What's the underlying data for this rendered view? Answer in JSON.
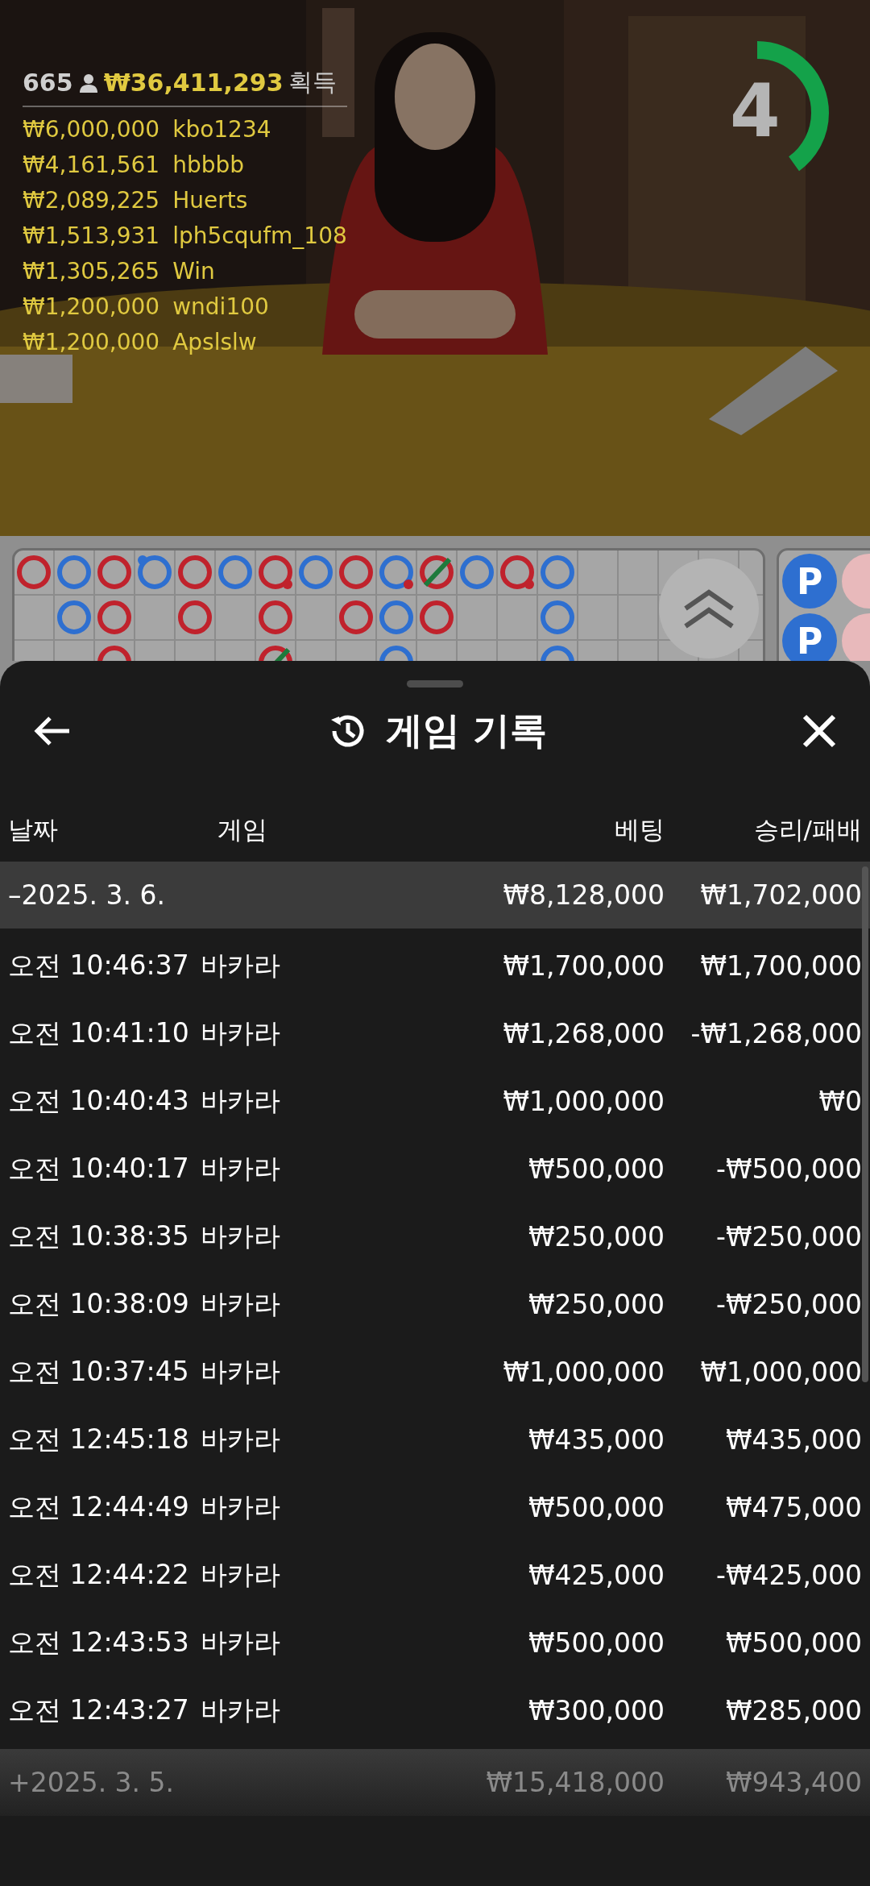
{
  "video": {
    "kind": "picture"
  },
  "timer": {
    "value": "4",
    "level": 0.4
  },
  "leaderboard": {
    "players": "665",
    "total": "₩36,411,293",
    "label": "획득",
    "entries": [
      {
        "amount": "₩6,000,000",
        "user": "kbo1234"
      },
      {
        "amount": "₩4,161,561",
        "user": "hbbbb"
      },
      {
        "amount": "₩2,089,225",
        "user": "Huerts"
      },
      {
        "amount": "₩1,513,931",
        "user": "lph5cqufm_108"
      },
      {
        "amount": "₩1,305,265",
        "user": "Win"
      },
      {
        "amount": "₩1,200,000",
        "user": "wndi100"
      },
      {
        "amount": "₩1,200,000",
        "user": "Apslslw"
      }
    ]
  },
  "big_road": {
    "rows": [
      [
        {
          "mark": true,
          "color": "#c0222c",
          "tie": false
        },
        {
          "mark": true,
          "color": "#2e6fd0",
          "tie": false
        },
        {
          "mark": true,
          "color": "#c0222c",
          "tie": false
        },
        {
          "mark": true,
          "color": "#2e6fd0",
          "tie": false,
          "player_pair": true
        },
        {
          "mark": true,
          "color": "#c0222c",
          "tie": false
        },
        {
          "mark": true,
          "color": "#2e6fd0",
          "tie": false
        },
        {
          "mark": true,
          "color": "#c0222c",
          "tie": false,
          "banker_pair": true
        },
        {
          "mark": true,
          "color": "#2e6fd0",
          "tie": false
        },
        {
          "mark": true,
          "color": "#c0222c",
          "tie": false
        },
        {
          "mark": true,
          "color": "#2e6fd0",
          "tie": false,
          "banker_pair": true
        },
        {
          "mark": true,
          "color": "#c0222c",
          "tie": true
        },
        {
          "mark": true,
          "color": "#2e6fd0",
          "tie": false
        },
        {
          "mark": true,
          "color": "#c0222c",
          "tie": false,
          "banker_pair": true
        },
        {
          "mark": true,
          "color": "#2e6fd0",
          "tie": false
        }
      ],
      [
        {
          "mark": false
        },
        {
          "mark": true,
          "color": "#2e6fd0",
          "tie": false
        },
        {
          "mark": true,
          "color": "#c0222c",
          "tie": false
        },
        {
          "mark": false
        },
        {
          "mark": true,
          "color": "#c0222c",
          "tie": false
        },
        {
          "mark": false
        },
        {
          "mark": true,
          "color": "#c0222c",
          "tie": false
        },
        {
          "mark": false
        },
        {
          "mark": true,
          "color": "#c0222c",
          "tie": false
        },
        {
          "mark": true,
          "color": "#2e6fd0",
          "tie": false
        },
        {
          "mark": true,
          "color": "#c0222c",
          "tie": false
        },
        {
          "mark": false
        },
        {
          "mark": false
        },
        {
          "mark": true,
          "color": "#2e6fd0",
          "tie": false
        }
      ],
      [
        {
          "mark": false
        },
        {
          "mark": false
        },
        {
          "mark": true,
          "color": "#c0222c",
          "tie": false
        },
        {
          "mark": false
        },
        {
          "mark": false
        },
        {
          "mark": false
        },
        {
          "mark": true,
          "color": "#c0222c",
          "tie": true
        },
        {
          "mark": false
        },
        {
          "mark": false
        },
        {
          "mark": true,
          "color": "#2e6fd0",
          "tie": false
        },
        {
          "mark": false
        },
        {
          "mark": false
        },
        {
          "mark": false
        },
        {
          "mark": true,
          "color": "#2e6fd0",
          "tie": false
        }
      ]
    ]
  },
  "bead_road": [
    [
      {
        "color": "#2e6fd0",
        "label": "P"
      },
      {
        "color": "#e8b9bb"
      }
    ],
    [
      {
        "color": "#2e6fd0",
        "label": "P"
      },
      {
        "color": "#e8b9bb"
      }
    ]
  ],
  "sheet": {
    "title": "게임 기록",
    "columns": [
      "날짜",
      "게임",
      "베팅",
      "승리/패배"
    ],
    "groups": [
      {
        "date": "–2025. 3. 6.",
        "bet": "₩8,128,000",
        "result": "₩1,702,000",
        "expanded": true,
        "rows": [
          {
            "time": "오전 10:46:37",
            "game": "바카라",
            "bet": "₩1,700,000",
            "result": "₩1,700,000"
          },
          {
            "time": "오전 10:41:10",
            "game": "바카라",
            "bet": "₩1,268,000",
            "result": "-₩1,268,000"
          },
          {
            "time": "오전 10:40:43",
            "game": "바카라",
            "bet": "₩1,000,000",
            "result": "₩0"
          },
          {
            "time": "오전 10:40:17",
            "game": "바카라",
            "bet": "₩500,000",
            "result": "-₩500,000"
          },
          {
            "time": "오전 10:38:35",
            "game": "바카라",
            "bet": "₩250,000",
            "result": "-₩250,000"
          },
          {
            "time": "오전 10:38:09",
            "game": "바카라",
            "bet": "₩250,000",
            "result": "-₩250,000"
          },
          {
            "time": "오전 10:37:45",
            "game": "바카라",
            "bet": "₩1,000,000",
            "result": "₩1,000,000"
          },
          {
            "time": "오전 12:45:18",
            "game": "바카라",
            "bet": "₩435,000",
            "result": "₩435,000"
          },
          {
            "time": "오전 12:44:49",
            "game": "바카라",
            "bet": "₩500,000",
            "result": "₩475,000"
          },
          {
            "time": "오전 12:44:22",
            "game": "바카라",
            "bet": "₩425,000",
            "result": "-₩425,000"
          },
          {
            "time": "오전 12:43:53",
            "game": "바카라",
            "bet": "₩500,000",
            "result": "₩500,000"
          },
          {
            "time": "오전 12:43:27",
            "game": "바카라",
            "bet": "₩300,000",
            "result": "₩285,000"
          }
        ]
      },
      {
        "date": "+2025. 3. 5.",
        "bet": "₩15,418,000",
        "result": "₩943,400",
        "expanded": false
      }
    ]
  }
}
